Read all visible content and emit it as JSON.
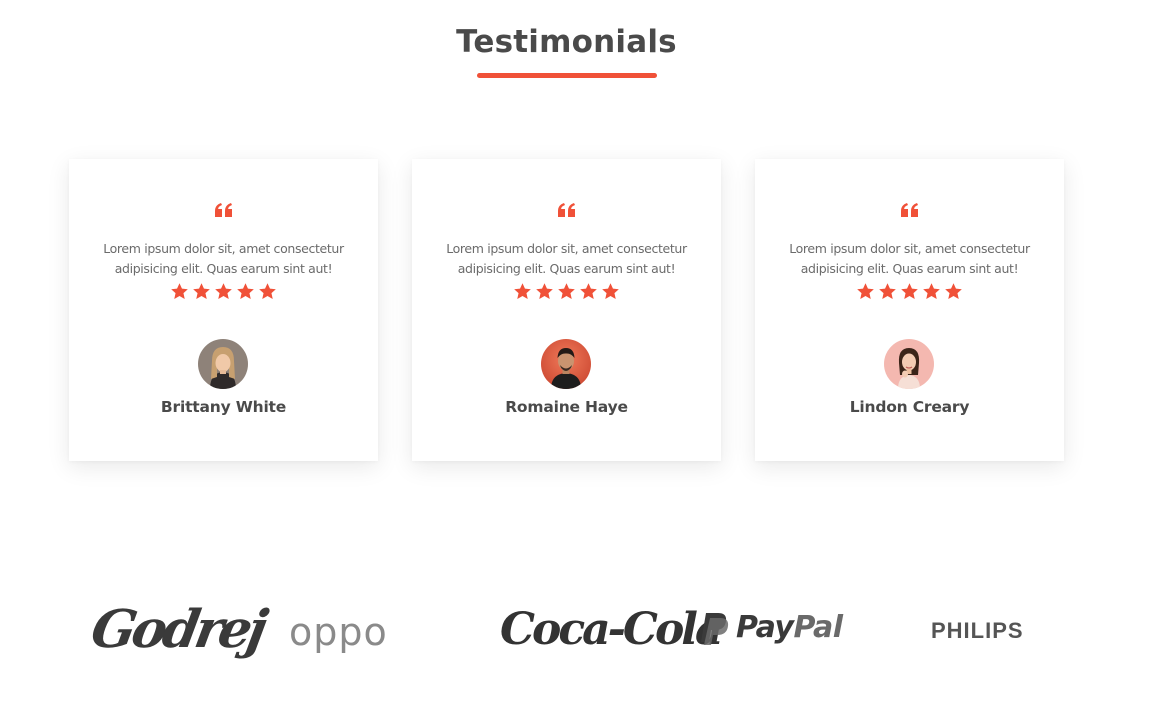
{
  "section": {
    "title": "Testimonials"
  },
  "colors": {
    "accent": "#f05138",
    "heading": "#4a4a4a",
    "body_text": "#6b6b6b"
  },
  "testimonials": [
    {
      "quote_icon": "quote-left-icon",
      "text": "Lorem ipsum dolor sit, amet consectetur adipisicing elit. Quas earum sint aut!",
      "rating": 5,
      "author": "Brittany White",
      "avatar": "avatar-woman-blonde"
    },
    {
      "quote_icon": "quote-left-icon",
      "text": "Lorem ipsum dolor sit, amet consectetur adipisicing elit. Quas earum sint aut!",
      "rating": 5,
      "author": "Romaine Haye",
      "avatar": "avatar-man-dark-hair"
    },
    {
      "quote_icon": "quote-left-icon",
      "text": "Lorem ipsum dolor sit, amet consectetur adipisicing elit. Quas earum sint aut!",
      "rating": 5,
      "author": "Lindon Creary",
      "avatar": "avatar-woman-pink-bg"
    }
  ],
  "brands": [
    {
      "name": "godrej-logo",
      "text": "Godrej"
    },
    {
      "name": "oppo-logo",
      "text": "oppo"
    },
    {
      "name": "coca-cola-logo",
      "text": "Coca-Cola"
    },
    {
      "name": "paypal-logo",
      "text": "PayPal",
      "text_part1": "Pay",
      "text_part2": "Pal"
    },
    {
      "name": "philips-logo",
      "text": "PHILIPS"
    }
  ]
}
